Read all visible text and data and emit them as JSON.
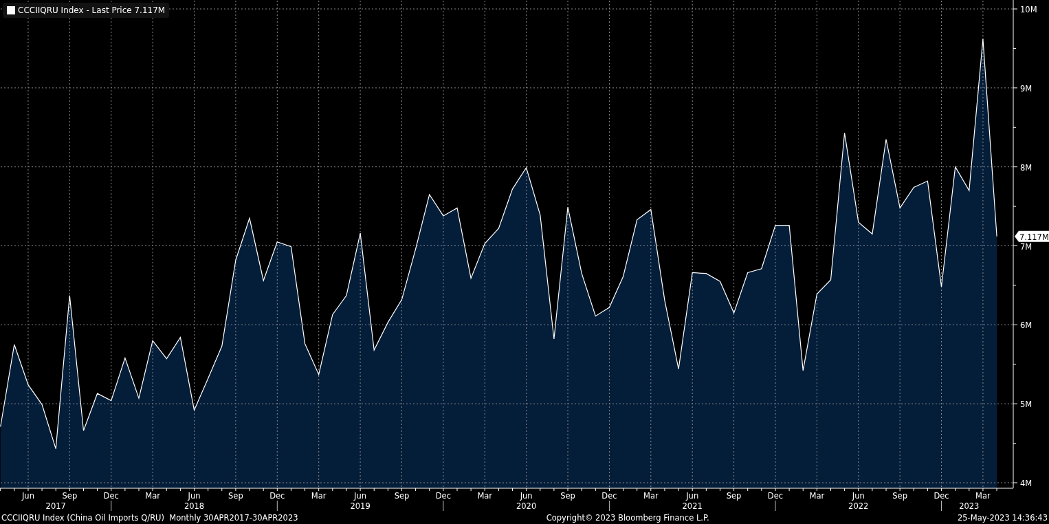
{
  "legend": {
    "value": "7.117M",
    "color": "#ffffff"
  },
  "last_price_marker": "7.117M",
  "chart_data": {
    "type": "area",
    "grid": true,
    "categories": [
      null,
      null,
      "Jun",
      null,
      null,
      "Sep",
      null,
      null,
      "Dec",
      null,
      null,
      "Mar",
      null,
      null,
      "Jun",
      null,
      null,
      "Sep",
      null,
      null,
      "Dec",
      null,
      null,
      "Mar",
      null,
      null,
      "Jun",
      null,
      null,
      "Sep",
      null,
      null,
      "Dec",
      null,
      null,
      "Mar",
      null,
      null,
      "Jun",
      null,
      null,
      "Sep",
      null,
      null,
      "Dec",
      null,
      null,
      "Mar",
      null,
      null,
      "Jun",
      null,
      null,
      "Sep",
      null,
      null,
      "Dec",
      null,
      null,
      "Mar",
      null,
      null,
      "Jun",
      null,
      null,
      "Sep",
      null,
      null,
      "Dec",
      null,
      null,
      "Mar",
      null
    ],
    "series": [
      {
        "name": "CCCIIQRU Index - Last Price",
        "color": "#ffffff",
        "values": [
          4.71,
          5.75,
          5.24,
          4.99,
          4.43,
          6.37,
          4.66,
          5.13,
          5.04,
          5.58,
          5.07,
          5.8,
          5.57,
          5.84,
          4.92,
          5.32,
          5.73,
          6.82,
          7.35,
          6.56,
          7.05,
          6.99,
          5.76,
          5.37,
          6.13,
          6.37,
          7.16,
          5.68,
          6.03,
          6.32,
          6.96,
          7.65,
          7.38,
          7.48,
          6.59,
          7.03,
          7.22,
          7.72,
          7.99,
          7.39,
          5.82,
          7.49,
          6.65,
          6.11,
          6.22,
          6.61,
          7.33,
          7.46,
          6.31,
          5.44,
          6.66,
          6.65,
          6.55,
          6.15,
          6.66,
          6.71,
          7.26,
          7.26,
          5.42,
          6.39,
          6.57,
          8.43,
          7.3,
          7.15,
          8.35,
          7.48,
          7.74,
          7.82,
          6.48,
          8.0,
          7.7,
          9.62,
          7.12
        ]
      }
    ],
    "ylim": [
      4,
      10
    ],
    "yticks": [
      {
        "value": 4,
        "label": "4M"
      },
      {
        "value": 5,
        "label": "5M"
      },
      {
        "value": 6,
        "label": "6M"
      },
      {
        "value": 7,
        "label": "7M"
      },
      {
        "value": 8,
        "label": "8M"
      },
      {
        "value": 9,
        "label": "9M"
      },
      {
        "value": 10,
        "label": "10M"
      }
    ],
    "annotations": [
      "2017",
      "2018",
      "2019",
      "2020",
      "2021",
      "2022",
      "2023"
    ]
  },
  "footer": {
    "description": "CCCIIQRU Index (China Oil Imports Q/RU)  Monthly 30APR2017-30APR2023",
    "copyright": "Copyright© 2023 Bloomberg Finance L.P.",
    "timestamp": "25-May-2023 14:36:43"
  }
}
